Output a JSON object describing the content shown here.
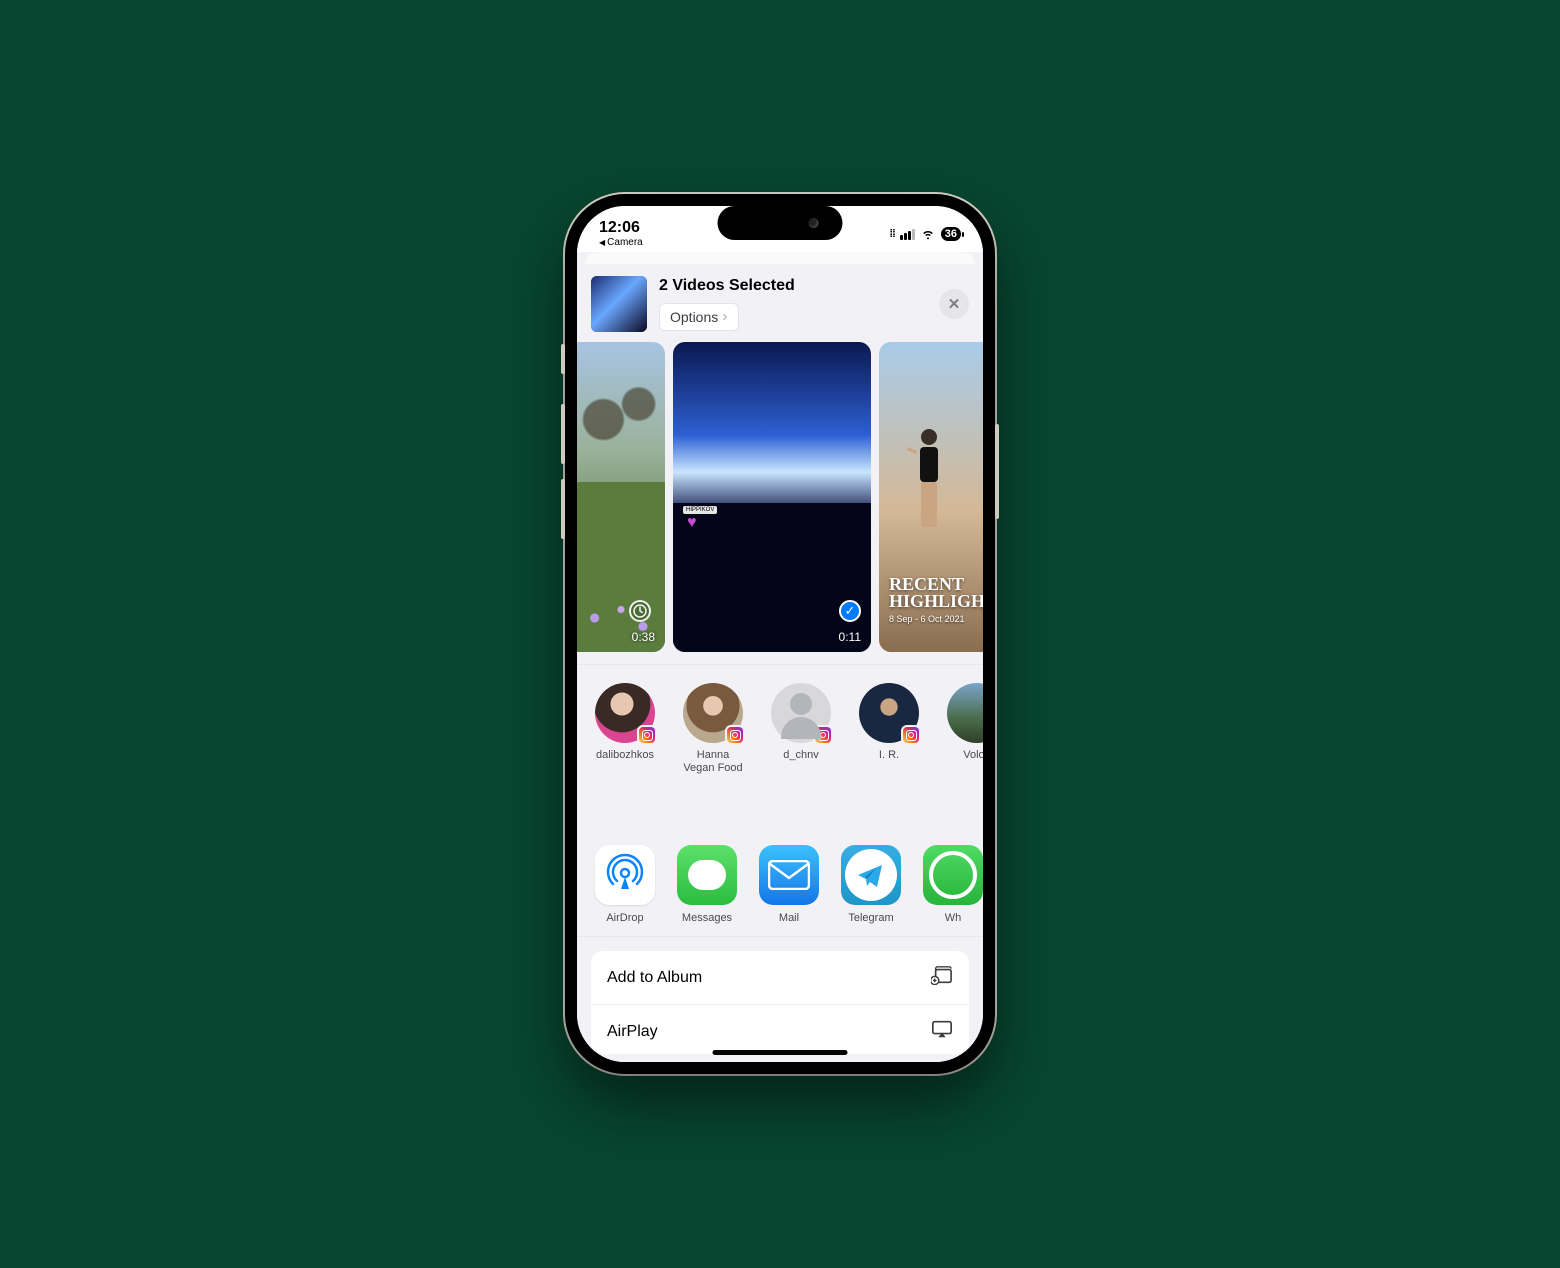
{
  "statusbar": {
    "time": "12:06",
    "back_app": "Camera",
    "battery": "36"
  },
  "header": {
    "title": "2 Videos Selected",
    "options_label": "Options"
  },
  "media": [
    {
      "duration": "0:38",
      "selected": false
    },
    {
      "duration": "0:11",
      "selected": true
    },
    {
      "overlay_title1": "RECENT",
      "overlay_title2": "HIGHLIGHTS",
      "overlay_sub": "8 Sep - 6 Oct 2021"
    }
  ],
  "people": [
    {
      "name": "dalibozhkos"
    },
    {
      "name": "Hanna Vegan Food"
    },
    {
      "name": "d_chnv"
    },
    {
      "name": "I. R."
    },
    {
      "name": "Volod"
    }
  ],
  "apps": [
    {
      "name": "AirDrop"
    },
    {
      "name": "Messages"
    },
    {
      "name": "Mail"
    },
    {
      "name": "Telegram"
    },
    {
      "name": "Wh"
    }
  ],
  "actions": [
    {
      "label": "Add to Album"
    },
    {
      "label": "AirPlay"
    }
  ]
}
